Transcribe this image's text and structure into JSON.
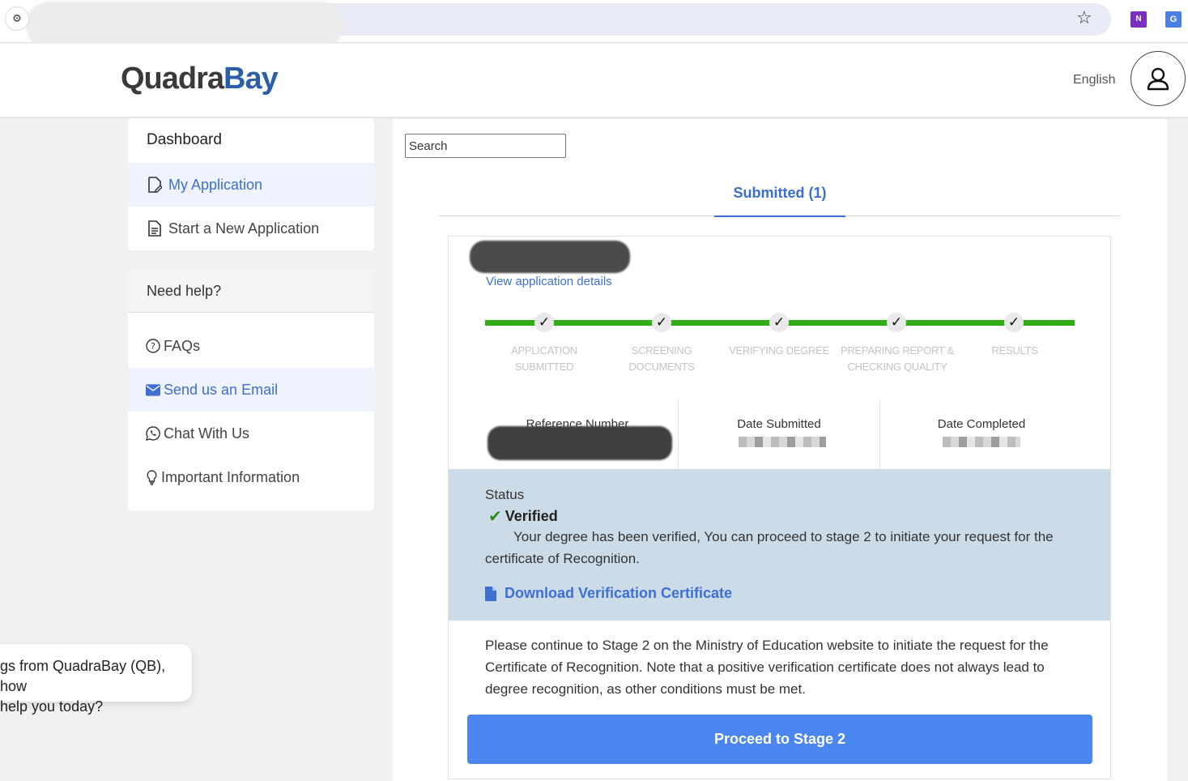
{
  "browser": {
    "tune_icon": "tune-icon",
    "star_icon": "star-icon",
    "extension_onenote": "N",
    "extension_translate": "G"
  },
  "header": {
    "logo_part1": "Quadra",
    "logo_part2": "Bay",
    "language": "English"
  },
  "sidebar": {
    "dashboard_title": "Dashboard",
    "items": [
      {
        "label": "My Application",
        "icon": "edit-document-icon"
      },
      {
        "label": "Start a New Application",
        "icon": "document-icon"
      }
    ],
    "help_title": "Need help?",
    "help_items": [
      {
        "label": "FAQs",
        "icon": "question-circle-icon"
      },
      {
        "label": "Send us an Email",
        "icon": "envelope-icon"
      },
      {
        "label": "Chat With Us",
        "icon": "whatsapp-icon"
      },
      {
        "label": "Important Information",
        "icon": "lightbulb-icon"
      }
    ]
  },
  "chat": {
    "line1": "gs from QuadraBay (QB), how",
    "line2": "help you today?"
  },
  "main": {
    "search_placeholder": "Search",
    "tab_submitted": "Submitted (1)",
    "view_details": "View application details",
    "steps": [
      {
        "line1": "APPLICATION",
        "line2": "SUBMITTED"
      },
      {
        "line1": "SCREENING",
        "line2": "DOCUMENTS"
      },
      {
        "line1": "VERIFYING DEGREE",
        "line2": ""
      },
      {
        "line1": "PREPARING REPORT &",
        "line2": "CHECKING QUALITY"
      },
      {
        "line1": "RESULTS",
        "line2": ""
      }
    ],
    "step_check": "✓",
    "info": {
      "reference_label": "Reference Number",
      "date_submitted_label": "Date Submitted",
      "date_completed_label": "Date Completed"
    },
    "status": {
      "label": "Status",
      "value": "Verified",
      "message": "Your degree has been verified, You can proceed to stage 2 to initiate your request for the certificate of Recognition.",
      "download": "Download Verification Certificate"
    },
    "note": "Please continue to Stage 2 on the Ministry of Education website to initiate the request for the Certificate of Recognition. Note that a positive verification certificate does not always lead to degree recognition, as other conditions must be met.",
    "proceed_button": "Proceed to Stage 2"
  },
  "colors": {
    "accent": "#3e6fd2",
    "progress": "#2fae16",
    "status_bg": "#cbdbe8",
    "button": "#4b86f0",
    "verified_check": "#2d8a1f"
  }
}
